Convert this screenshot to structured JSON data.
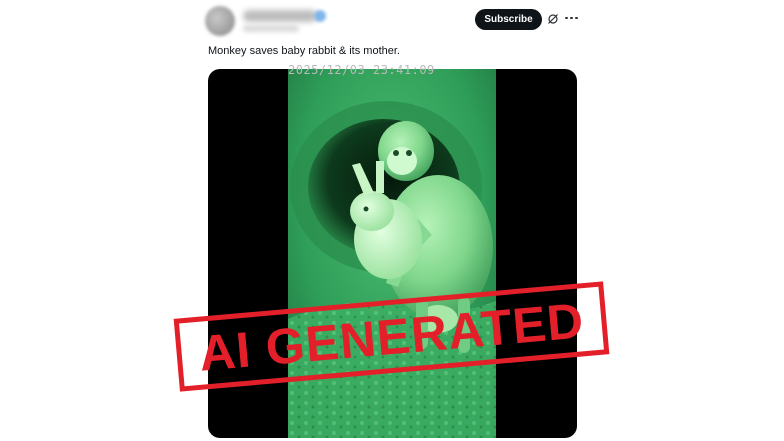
{
  "header": {
    "subscribe_label": "Subscribe",
    "grok_icon": "grok-icon",
    "more_icon": "more-icon"
  },
  "post": {
    "text": "Monkey saves baby rabbit & its mother."
  },
  "media": {
    "timestamp": "2025/12/03  23:41:09",
    "overlay_color": "#2fa35f"
  },
  "stamp": {
    "text": "AI GENERATED",
    "color": "#e3202a"
  }
}
